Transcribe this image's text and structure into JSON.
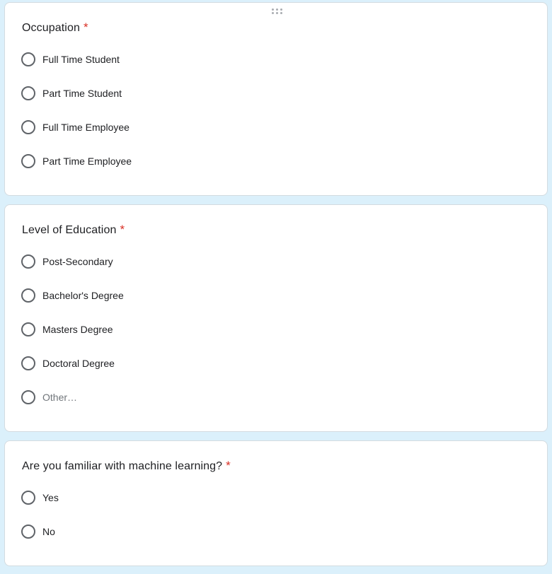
{
  "questions": [
    {
      "title": "Occupation",
      "required_mark": "*",
      "options": [
        "Full Time Student",
        "Part Time Student",
        "Full Time Employee",
        "Part Time Employee"
      ]
    },
    {
      "title": "Level of Education",
      "required_mark": "*",
      "options": [
        "Post-Secondary",
        "Bachelor's Degree",
        "Masters Degree",
        "Doctoral Degree"
      ],
      "other_label": "Other…"
    },
    {
      "title": "Are you familiar with machine learning?",
      "required_mark": "*",
      "options": [
        "Yes",
        "No"
      ]
    }
  ],
  "colors": {
    "page_background": "#dbf0fb",
    "card_background": "#ffffff",
    "required_asterisk": "#d93025",
    "radio_border": "#5f6368"
  },
  "icons": {
    "drag_handle": "drag-handle-icon",
    "radio": "radio-unchecked-icon"
  }
}
